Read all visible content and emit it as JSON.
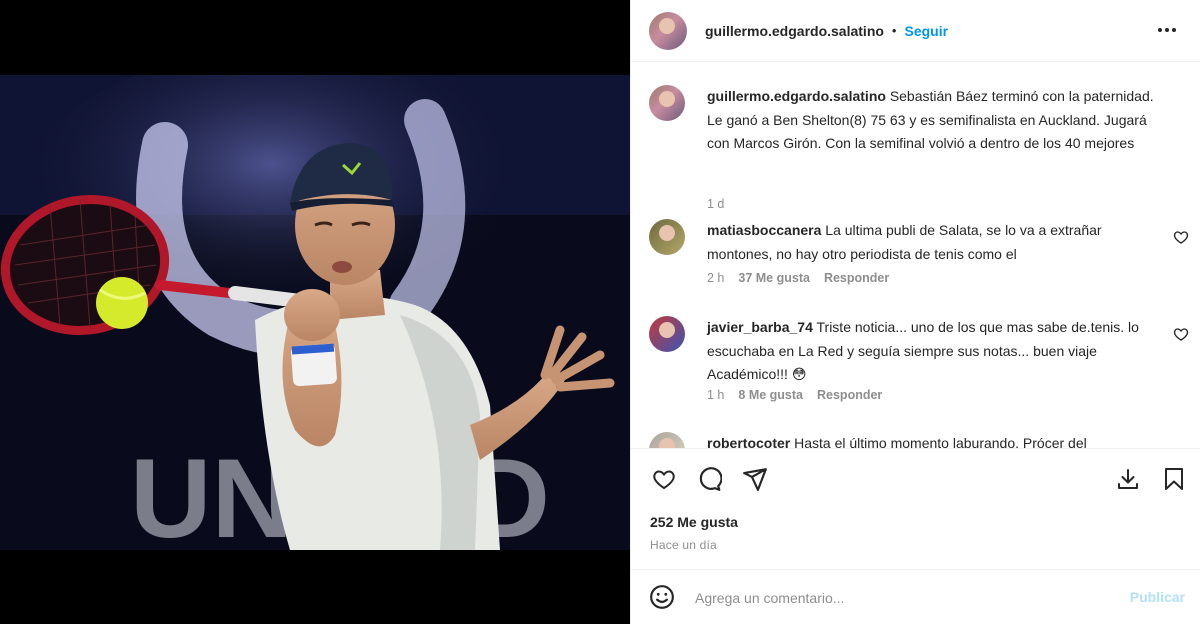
{
  "post": {
    "author": "guillermo.edgardo.salatino",
    "separator": "•",
    "follow_label": "Seguir",
    "more_icon": "more-horizontal-icon",
    "caption": "Sebastián Báez terminó con la paternidad. Le ganó a Ben Shelton(8) 75 63 y es semifinalista en Auckland. Jugará con Marcos Girón. Con la semifinal volvió a dentro de los 40 mejores",
    "caption_time": "1 d",
    "likes": "252 Me gusta",
    "date": "Hace un día"
  },
  "comments": [
    {
      "user": "matiasboccanera",
      "text": "La ultima publi de Salata, se lo va a extrañar montones, no hay otro periodista de tenis como el",
      "time": "2 h",
      "likes": "37 Me gusta",
      "reply": "Responder"
    },
    {
      "user": "javier_barba_74",
      "text": "Triste noticia... uno de los que mas sabe de.tenis. lo escuchaba en La Red y seguía siempre sus notas... buen viaje Académico!!! 😳",
      "time": "1 h",
      "likes": "8 Me gusta",
      "reply": "Responder"
    },
    {
      "user": "robertocoter",
      "text": "Hasta el último momento laburando. Prócer del"
    }
  ],
  "image": {
    "backdrop_text": "UNITED"
  },
  "actions": {
    "icons": [
      "heart-icon",
      "comment-icon",
      "share-icon",
      "save-icon",
      "bookmark-icon"
    ]
  },
  "composer": {
    "placeholder": "Agrega un comentario...",
    "publish_label": "Publicar"
  },
  "colors": {
    "accent": "#0095f6",
    "publish_disabled": "#b2dffc",
    "secondary_text": "#8e8e8e"
  }
}
